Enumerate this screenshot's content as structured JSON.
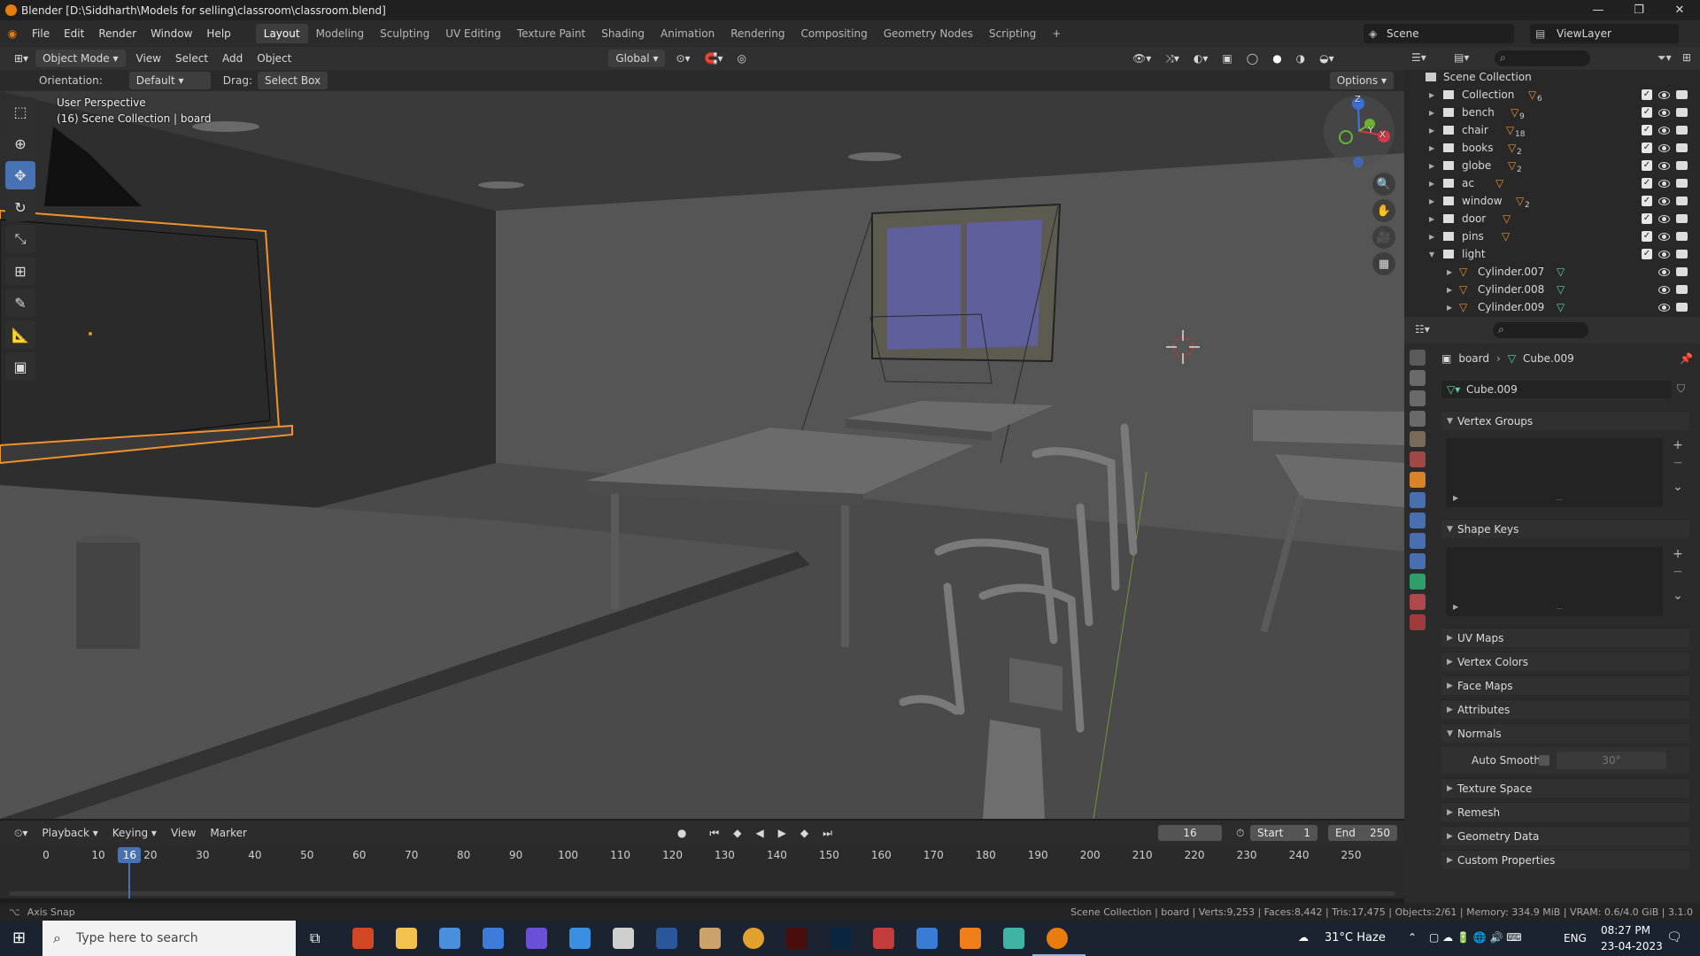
{
  "window": {
    "title": "Blender [D:\\Siddharth\\Models for selling\\classroom\\classroom.blend]"
  },
  "menu": [
    "File",
    "Edit",
    "Render",
    "Window",
    "Help"
  ],
  "workspaces": [
    "Layout",
    "Modeling",
    "Sculpting",
    "UV Editing",
    "Texture Paint",
    "Shading",
    "Animation",
    "Rendering",
    "Compositing",
    "Geometry Nodes",
    "Scripting",
    "+"
  ],
  "active_workspace": "Layout",
  "scene": "Scene",
  "view_layer": "ViewLayer",
  "viewport_header": {
    "mode": "Object Mode",
    "menus": [
      "View",
      "Select",
      "Add",
      "Object"
    ],
    "transform_orientation": "Global",
    "orientation_label": "Orientation:",
    "orientation_value": "Default",
    "drag_label": "Drag:",
    "drag_value": "Select Box",
    "options": "Options"
  },
  "viewport": {
    "view_name": "User Perspective",
    "view_info": "(16) Scene Collection | board",
    "gizmo_axes": [
      "Z",
      "Y",
      "X"
    ]
  },
  "outliner": {
    "root": "Scene Collection",
    "items": [
      {
        "label": "Collection",
        "count": "6",
        "expanded": false
      },
      {
        "label": "bench",
        "count": "9",
        "expanded": false
      },
      {
        "label": "chair",
        "count": "18",
        "expanded": false
      },
      {
        "label": "books",
        "count": "2",
        "expanded": false
      },
      {
        "label": "globe",
        "count": "2",
        "expanded": false
      },
      {
        "label": "ac",
        "count": "",
        "expanded": false
      },
      {
        "label": "window",
        "count": "2",
        "expanded": false
      },
      {
        "label": "door",
        "count": "",
        "expanded": false
      },
      {
        "label": "pins",
        "count": "",
        "expanded": false
      },
      {
        "label": "light",
        "count": "",
        "expanded": true
      }
    ],
    "children": [
      "Cylinder.007",
      "Cylinder.008",
      "Cylinder.009"
    ]
  },
  "properties": {
    "breadcrumb_object": "board",
    "breadcrumb_data": "Cube.009",
    "datablock": "Cube.009",
    "panels": [
      {
        "label": "Vertex Groups",
        "open": true
      },
      {
        "label": "Shape Keys",
        "open": true
      },
      {
        "label": "UV Maps",
        "open": false
      },
      {
        "label": "Vertex Colors",
        "open": false
      },
      {
        "label": "Face Maps",
        "open": false
      },
      {
        "label": "Attributes",
        "open": false
      },
      {
        "label": "Normals",
        "open": true
      },
      {
        "label": "Texture Space",
        "open": false
      },
      {
        "label": "Remesh",
        "open": false
      },
      {
        "label": "Geometry Data",
        "open": false
      },
      {
        "label": "Custom Properties",
        "open": false
      }
    ],
    "auto_smooth_label": "Auto Smooth",
    "auto_smooth_angle": "30°"
  },
  "timeline": {
    "menus": [
      "Playback",
      "Keying",
      "View",
      "Marker"
    ],
    "current_frame": "16",
    "start_label": "Start",
    "start": "1",
    "end_label": "End",
    "end": "250",
    "ticks": [
      "0",
      "10",
      "20",
      "30",
      "40",
      "50",
      "60",
      "70",
      "80",
      "90",
      "100",
      "110",
      "120",
      "130",
      "140",
      "150",
      "160",
      "170",
      "180",
      "190",
      "200",
      "210",
      "220",
      "230",
      "240",
      "250"
    ],
    "playhead": "16"
  },
  "statusbar": {
    "left": "Axis Snap",
    "right": "Scene Collection | board | Verts:9,253 | Faces:8,442 | Tris:17,475 | Objects:2/61 | Memory: 334.9 MiB | VRAM: 0.6/4.0 GiB | 3.1.0"
  },
  "taskbar": {
    "search_placeholder": "Type here to search",
    "weather": "31°C  Haze",
    "language": "ENG",
    "time": "08:27 PM",
    "date": "23-04-2023"
  },
  "colors": {
    "accent": "#4772b3",
    "selection": "#f0922b",
    "window_glass": "#5f5f9c"
  }
}
